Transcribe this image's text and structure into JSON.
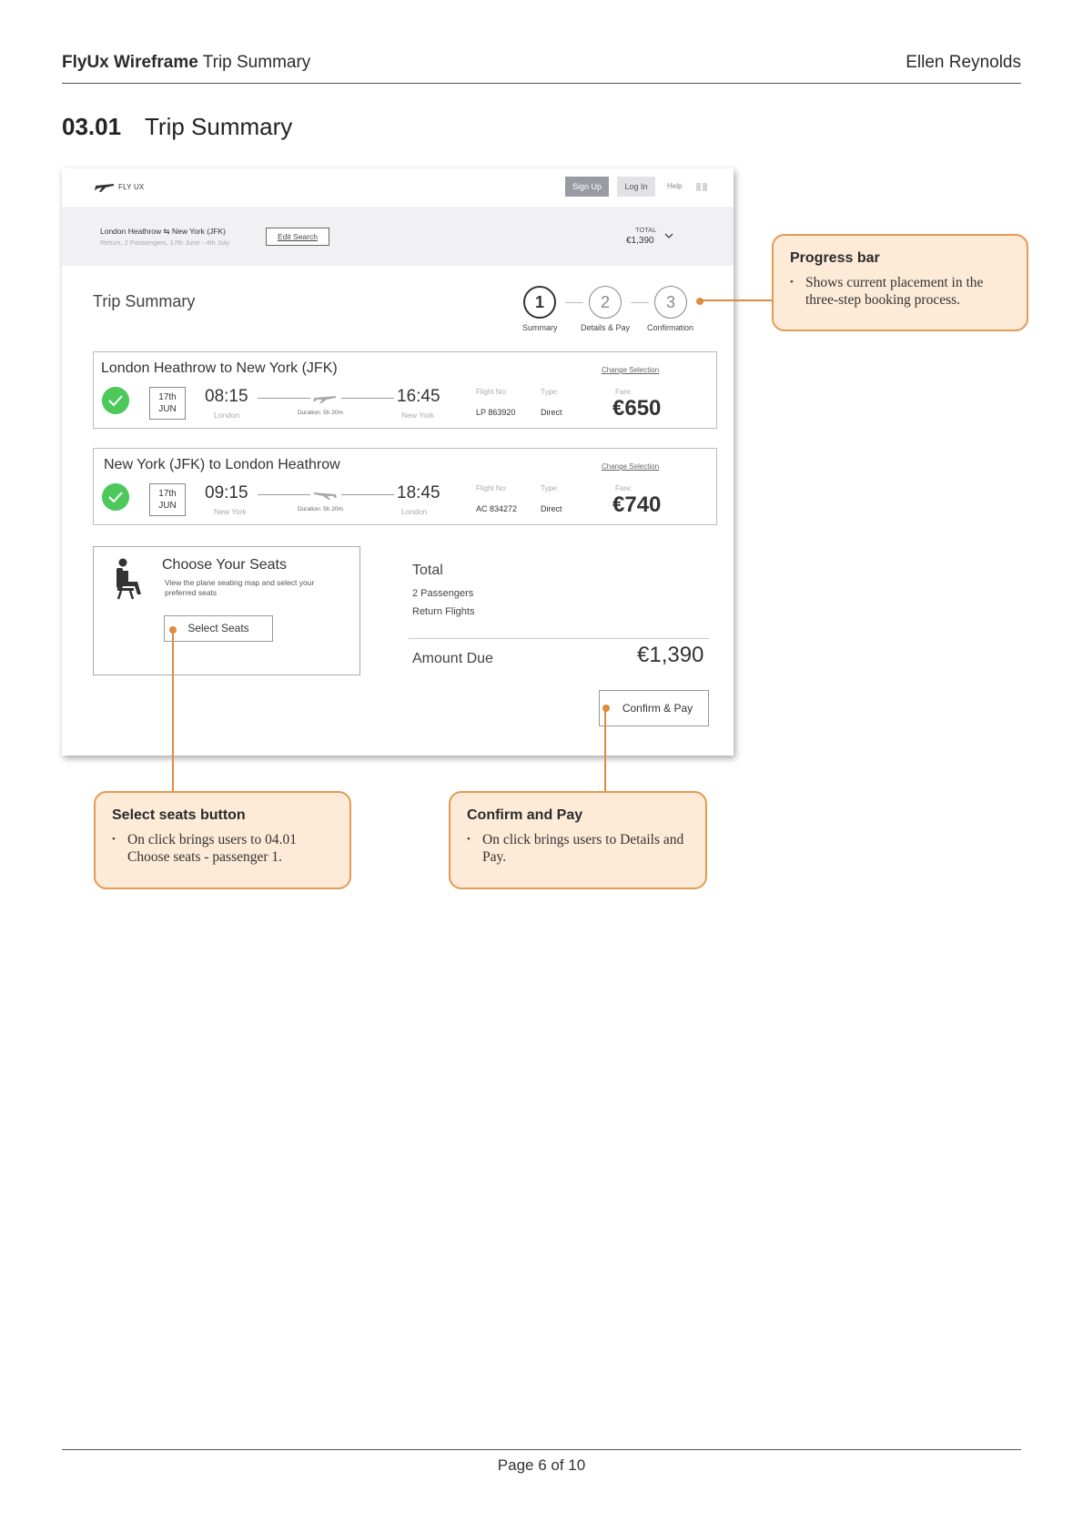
{
  "document": {
    "header_bold": "FlyUx Wireframe",
    "header_rest": "Trip Summary",
    "author": "Ellen Reynolds",
    "section_number": "03.01",
    "section_title": "Trip Summary",
    "page_label": "Page 6 of 10"
  },
  "nav": {
    "logo_text": "FLY UX",
    "signup_label": "Sign Up",
    "login_label": "Log In",
    "help_label": "Help"
  },
  "search": {
    "route": "London Heathrow ⇆ New York (JFK)",
    "details": "Return, 2 Passengers, 17th June - 4th July",
    "edit_label": "Edit Search",
    "total_label": "TOTAL",
    "total_value": "€1,390"
  },
  "page": {
    "title": "Trip Summary"
  },
  "progress": {
    "steps": [
      {
        "number": "1",
        "label": "Summary",
        "state": "active"
      },
      {
        "number": "2",
        "label": "Details & Pay",
        "state": "inactive"
      },
      {
        "number": "3",
        "label": "Confirmation",
        "state": "inactive"
      }
    ]
  },
  "flights": [
    {
      "title": "London Heathrow to New York (JFK)",
      "change_label": "Change Selection",
      "day": "17th",
      "month": "JUN",
      "depart_time": "08:15",
      "depart_city": "London",
      "duration": "Duration: 5h 20m",
      "arrive_time": "16:45",
      "arrive_city": "New York",
      "flight_no_label": "Flight No:",
      "flight_no": "LP 863920",
      "type_label": "Type:",
      "type": "Direct",
      "fare_label": "Fare:",
      "fare": "€650"
    },
    {
      "title": "New York (JFK) to London Heathrow",
      "change_label": "Change Selection",
      "day": "17th",
      "month": "JUN",
      "depart_time": "09:15",
      "depart_city": "New York",
      "duration": "Duration: 5h 20m",
      "arrive_time": "18:45",
      "arrive_city": "London",
      "flight_no_label": "Flight No:",
      "flight_no": "AC 834272",
      "type_label": "Type:",
      "type": "Direct",
      "fare_label": "Fare:",
      "fare": "€740"
    }
  ],
  "seats": {
    "title": "Choose Your Seats",
    "description": "View the plane seating map and select your preferred seats",
    "button_label": "Select Seats"
  },
  "totals": {
    "title": "Total",
    "passengers": "2 Passengers",
    "flights": "Return Flights",
    "amount_label": "Amount Due",
    "amount_value": "€1,390",
    "confirm_label": "Confirm & Pay"
  },
  "annotations": {
    "progress": {
      "title": "Progress bar",
      "body": "Shows current placement in the three-step booking process."
    },
    "seats": {
      "title": "Select seats button",
      "body": "On click brings users to 04.01 Choose seats - passenger 1."
    },
    "confirm": {
      "title": "Confirm and Pay",
      "body": "On click brings users to Details and Pay."
    }
  },
  "colors": {
    "annotation_fill": "#fdebd8",
    "annotation_border": "#e49a55",
    "connector": "#e08a3e",
    "success_check": "#4cc95a",
    "signup_button": "#9a9aa3"
  },
  "icons": [
    "plane-logo-icon",
    "menu-icon",
    "swap-arrows-icon",
    "chevron-down-icon",
    "check-icon",
    "plane-icon",
    "seat-icon"
  ]
}
